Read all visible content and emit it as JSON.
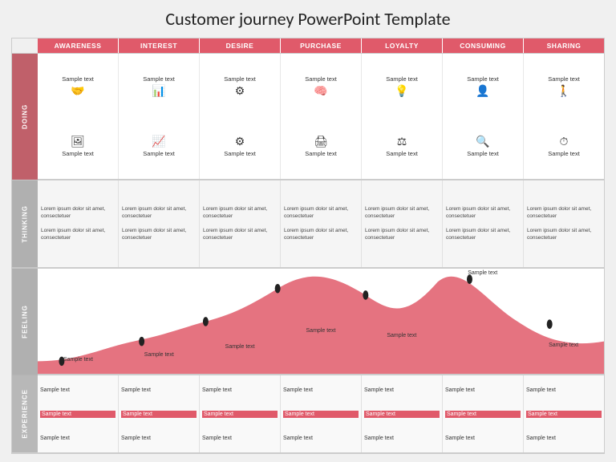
{
  "title": "Customer journey PowerPoint Template",
  "columns": [
    "AWARENESS",
    "INTEREST",
    "DESIRE",
    "PURCHASE",
    "LOYALTY",
    "CONSUMING",
    "SHARING"
  ],
  "sections": {
    "doing": {
      "label": "DOING",
      "cells": [
        {
          "top_text": "Sample text",
          "top_icon": "🤝",
          "bottom_icon": "🖼",
          "bottom_text": "Sample text"
        },
        {
          "top_text": "Sample text",
          "top_icon": "📊",
          "bottom_icon": "📈",
          "bottom_text": "Sample text"
        },
        {
          "top_text": "Sample text",
          "top_icon": "⚙",
          "bottom_icon": "⚙",
          "bottom_text": "Sample text"
        },
        {
          "top_text": "Sample text",
          "top_icon": "🧠",
          "bottom_icon": "🖨",
          "bottom_text": "Sample text"
        },
        {
          "top_text": "Sample text",
          "top_icon": "💡",
          "bottom_icon": "⚖",
          "bottom_text": "Sample text"
        },
        {
          "top_text": "Sample text",
          "top_icon": "👤",
          "bottom_icon": "🔍",
          "bottom_text": "Sample text"
        },
        {
          "top_text": "Sample text",
          "top_icon": "🚶",
          "bottom_icon": "⏱",
          "bottom_text": "Sample text"
        }
      ]
    },
    "thinking": {
      "label": "THINKING",
      "lorem": "Lorem ipsum dolor sit amet, consectetuer"
    },
    "feeling": {
      "label": "FEELING",
      "texts": [
        "Sample text",
        "Sample text",
        "Sample text",
        "Sample text",
        "Sample text",
        "Sample text",
        "Sample text"
      ]
    },
    "experience": {
      "label": "EXPERIENCE",
      "rows": [
        [
          "Sample text",
          "Sample text",
          "Sample text",
          "Sample text",
          "Sample text",
          "Sample text",
          "Sample text"
        ],
        [
          "Sample text",
          "Sample text",
          "Sample text",
          "Sample text",
          "Sample text",
          "Sample text",
          "Sample text"
        ],
        [
          "Sample text",
          "Sample text",
          "Sample text",
          "Sample text",
          "Sample text",
          "Sample text",
          "Sample text"
        ]
      ],
      "highlighted_row": 1
    }
  }
}
